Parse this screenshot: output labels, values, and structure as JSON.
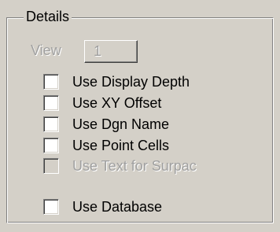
{
  "details_group": {
    "title": "Details"
  },
  "view": {
    "label": "View",
    "button_value": "1"
  },
  "options": [
    {
      "label": "Use Display Depth",
      "checked": false,
      "enabled": true
    },
    {
      "label": "Use XY Offset",
      "checked": false,
      "enabled": true
    },
    {
      "label": "Use Dgn Name",
      "checked": false,
      "enabled": true
    },
    {
      "label": "Use Point Cells",
      "checked": false,
      "enabled": true
    },
    {
      "label": "Use Text for Surpac",
      "checked": false,
      "enabled": false
    }
  ],
  "database_option": {
    "label": "Use Database",
    "checked": false,
    "enabled": true
  },
  "colors": {
    "face": "#d4d0c8",
    "disabled_text": "#a0a0a0",
    "shadow": "#808080",
    "highlight": "#ffffff"
  }
}
